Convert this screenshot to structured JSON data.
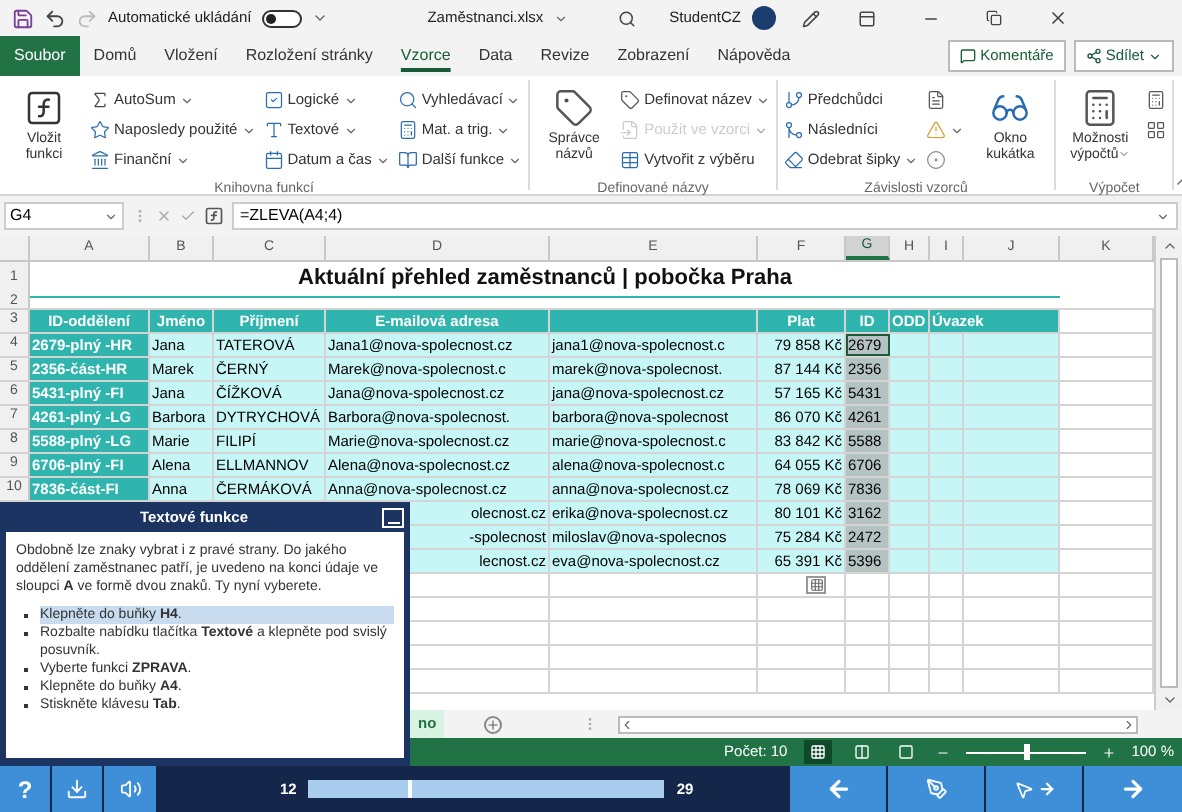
{
  "titlebar": {
    "autosave_label": "Automatické ukládání",
    "autosave_on": false,
    "filename": "Zaměstnanci.xlsx",
    "user": "StudentCZ"
  },
  "tabs": [
    {
      "label": "Soubor",
      "kind": "file",
      "selected": false
    },
    {
      "label": "Domů",
      "kind": "tab",
      "selected": false
    },
    {
      "label": "Vložení",
      "kind": "tab",
      "selected": false
    },
    {
      "label": "Rozložení stránky",
      "kind": "tab",
      "selected": false
    },
    {
      "label": "Vzorce",
      "kind": "tab",
      "selected": true
    },
    {
      "label": "Data",
      "kind": "tab",
      "selected": false
    },
    {
      "label": "Revize",
      "kind": "tab",
      "selected": false
    },
    {
      "label": "Zobrazení",
      "kind": "tab",
      "selected": false
    },
    {
      "label": "Nápověda",
      "kind": "tab",
      "selected": false
    }
  ],
  "comments_button": "Komentáře",
  "share_button": "Sdílet",
  "ribbon_groups": [
    {
      "label": "Knihovna funkcí",
      "big": [
        {
          "label": "Vložit funkci",
          "dropdown": false
        }
      ],
      "columns": [
        [
          {
            "label": "AutoSum",
            "dropdown": true,
            "disabled": false
          },
          {
            "label": "Naposledy použité",
            "dropdown": true,
            "disabled": false
          },
          {
            "label": "Finanční",
            "dropdown": true,
            "disabled": false
          }
        ],
        [
          {
            "label": "Logické",
            "dropdown": true,
            "disabled": false
          },
          {
            "label": "Textové",
            "dropdown": true,
            "disabled": false
          },
          {
            "label": "Datum a čas",
            "dropdown": true,
            "disabled": false
          }
        ],
        [
          {
            "label": "Vyhledávací",
            "dropdown": true,
            "disabled": false
          },
          {
            "label": "Mat. a trig.",
            "dropdown": true,
            "disabled": false
          },
          {
            "label": "Další funkce",
            "dropdown": true,
            "disabled": false
          }
        ]
      ]
    },
    {
      "label": "Definované názvy",
      "big": [
        {
          "label": "Správce názvů",
          "dropdown": false
        }
      ],
      "columns": [
        [
          {
            "label": "Definovat název",
            "dropdown": true,
            "disabled": false
          },
          {
            "label": "Použít ve vzorci",
            "dropdown": true,
            "disabled": true
          },
          {
            "label": "Vytvořit z výběru",
            "dropdown": false,
            "disabled": false
          }
        ]
      ]
    },
    {
      "label": "Závislosti vzorců",
      "columns": [
        [
          {
            "label": "Předchůdci",
            "dropdown": false,
            "disabled": false
          },
          {
            "label": "Následníci",
            "dropdown": false,
            "disabled": false
          },
          {
            "label": "Odebrat šipky",
            "dropdown": true,
            "disabled": false
          }
        ],
        [
          {
            "dropdown": false,
            "disabled": false
          },
          {
            "dropdown": true,
            "disabled": false
          },
          {
            "dropdown": false,
            "disabled": false
          }
        ]
      ],
      "big_after": [
        {
          "label": "Okno kukátka",
          "dropdown": false
        }
      ]
    },
    {
      "label": "Výpočet",
      "big": [
        {
          "label": "Možnosti výpočtů",
          "dropdown": true
        }
      ],
      "columns": [
        [
          {
            "dropdown": false,
            "disabled": false
          },
          {
            "dropdown": false,
            "disabled": false
          }
        ]
      ]
    }
  ],
  "formula_bar": {
    "name_box": "G4",
    "formula": "=ZLEVA(A4;4)"
  },
  "sheet": {
    "columns": [
      {
        "label": "A",
        "selected": false
      },
      {
        "label": "B",
        "selected": false
      },
      {
        "label": "C",
        "selected": false
      },
      {
        "label": "D",
        "selected": false
      },
      {
        "label": "E",
        "selected": false
      },
      {
        "label": "F",
        "selected": false
      },
      {
        "label": "G",
        "selected": true
      },
      {
        "label": "H",
        "selected": false
      },
      {
        "label": "I",
        "selected": false
      },
      {
        "label": "J",
        "selected": false
      },
      {
        "label": "K",
        "selected": false
      }
    ],
    "top_row_numbers": [
      "1",
      "2",
      "3"
    ],
    "title": "Aktuální přehled zaměstnanců | pobočka Praha",
    "header": {
      "A": "ID-oddělení",
      "B": "Jméno",
      "C": "Příjmení",
      "D": "E-mailová adresa",
      "F": "Plat",
      "G": "ID",
      "H": "ODD",
      "I": "Úvazek"
    },
    "rows": [
      {
        "number": "4",
        "cells": {
          "A": "2679-plný -HR",
          "B": "Jana",
          "C": "TATEROVÁ",
          "D": "Jana1@nova-spolecnost.cz",
          "E": "jana1@nova-spolecnost.c",
          "F": "79 858 Kč",
          "G": "2679"
        }
      },
      {
        "number": "5",
        "cells": {
          "A": "2356-část-HR",
          "B": "Marek",
          "C": "ČERNÝ",
          "D": "Marek@nova-spolecnost.c",
          "E": "marek@nova-spolecnost.",
          "F": "87 144 Kč",
          "G": "2356"
        }
      },
      {
        "number": "6",
        "cells": {
          "A": "5431-plný -FI",
          "B": "Jana",
          "C": "ČÍŽKOVÁ",
          "D": "Jana@nova-spolecnost.cz",
          "E": "jana@nova-spolecnost.cz",
          "F": "57 165 Kč",
          "G": "5431"
        }
      },
      {
        "number": "7",
        "cells": {
          "A": "4261-plný -LG",
          "B": "Barbora",
          "C": "DYTRYCHOVÁ",
          "D": "Barbora@nova-spolecnost.",
          "E": "barbora@nova-spolecnost",
          "F": "86 070 Kč",
          "G": "4261"
        }
      },
      {
        "number": "8",
        "cells": {
          "A": "5588-plný -LG",
          "B": "Marie",
          "C": "FILIPÍ",
          "D": "Marie@nova-spolecnost.cz",
          "E": "marie@nova-spolecnost.c",
          "F": "83 842 Kč",
          "G": "5588"
        }
      },
      {
        "number": "9",
        "cells": {
          "A": "6706-plný -FI",
          "B": "Alena",
          "C": "ELLMANNOV",
          "D": "Alena@nova-spolecnost.cz",
          "E": "alena@nova-spolecnost.c",
          "F": "64 055 Kč",
          "G": "6706"
        }
      },
      {
        "number": "10",
        "cells": {
          "A": "7836-část-FI",
          "B": "Anna",
          "C": "ČERMÁKOVÁ",
          "D": "Anna@nova-spolecnost.cz",
          "E": "anna@nova-spolecnost.cz",
          "F": "78 069 Kč",
          "G": "7836"
        }
      },
      {
        "cells": {
          "D": "olecnost.cz",
          "E": "erika@nova-spolecnost.cz",
          "F": "80 101 Kč",
          "G": "3162"
        }
      },
      {
        "cells": {
          "D": "-spolecnost",
          "E": "miloslav@nova-spolecnos",
          "F": "75 284 Kč",
          "G": "2472"
        }
      },
      {
        "cells": {
          "D": "lecnost.cz",
          "E": "eva@nova-spolecnost.cz",
          "F": "65 391 Kč",
          "G": "5396"
        }
      }
    ],
    "sheet_tab": "no"
  },
  "status_bar": {
    "count": "Počet: 10",
    "views": [
      {
        "kind": "normal",
        "selected": true
      },
      {
        "kind": "page_layout",
        "selected": false
      },
      {
        "kind": "page_break",
        "selected": false
      }
    ],
    "zoom_slider": {
      "level": 0.5
    },
    "zoom": "100 %"
  },
  "lesson_panel": {
    "title": "Textové funkce",
    "text": "Obdobně lze znaky vybrat i z pravé strany. Do jakého oddělení zaměstnanec patří, je uvedeno na konci údaje ve sloupci **A** ve formě dvou znaků. Ty nyní vyberete.",
    "steps": [
      {
        "text": "Klepněte do buňky **H4**.",
        "current": true
      },
      {
        "text": "Rozbalte nabídku tlačítka **Textové** a klepněte pod svislý posuvník.",
        "current": false
      },
      {
        "text": "Vyberte funkci **ZPRAVA**.",
        "current": false
      },
      {
        "text": "Klepněte do buňky **A4**.",
        "current": false
      },
      {
        "text": "Stiskněte klávesu **Tab**.",
        "current": false
      }
    ]
  },
  "bottom_bar": {
    "help": "?",
    "progress_start": "12",
    "progress": {
      "level": 0.28
    },
    "progress_end": "29"
  }
}
